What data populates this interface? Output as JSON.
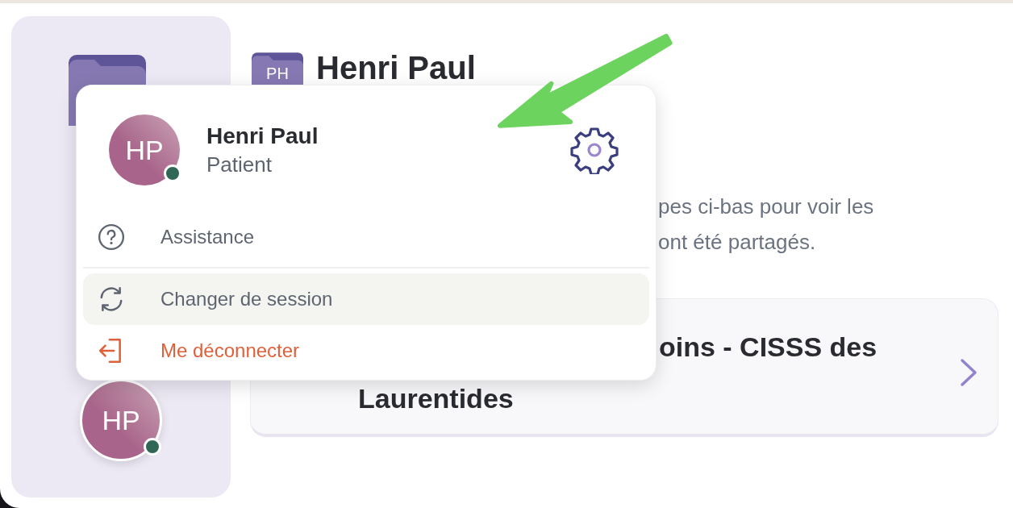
{
  "sidebar": {
    "avatar_initials": "HP"
  },
  "header": {
    "folder_badge": "PH",
    "title": "Henri Paul"
  },
  "intro_lines": [
    "pes ci-bas pour voir les",
    "ont été partagés."
  ],
  "card": {
    "title_lines": [
      "oins - CISSS des",
      "Laurentides"
    ]
  },
  "profile_menu": {
    "avatar_initials": "HP",
    "name": "Henri Paul",
    "role": "Patient",
    "items": [
      {
        "kind": "help",
        "label": "Assistance",
        "highlighted": false
      },
      {
        "kind": "switch",
        "label": "Changer de session",
        "highlighted": true
      },
      {
        "kind": "logout",
        "label": "Me déconnecter",
        "highlighted": false
      }
    ]
  }
}
